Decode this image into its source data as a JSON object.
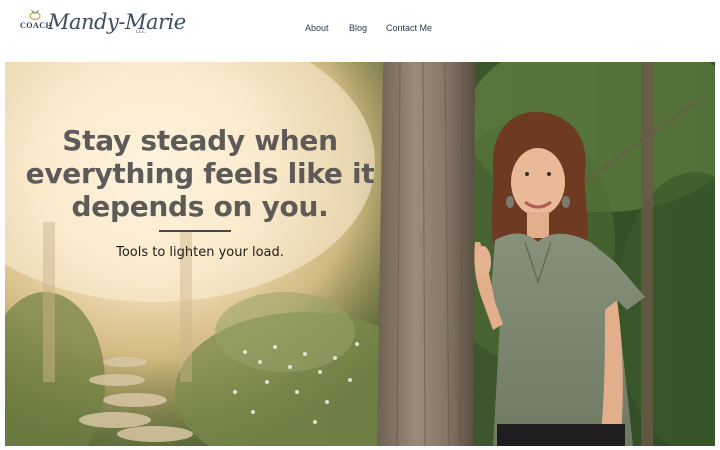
{
  "header": {
    "logo": {
      "prefix": "COACH",
      "name": "Mandy-Marie",
      "suffix": "LLC",
      "icon": "ring-sprout-icon"
    },
    "nav": [
      {
        "label": "About"
      },
      {
        "label": "Blog"
      },
      {
        "label": "Contact Me"
      }
    ]
  },
  "hero": {
    "headline": "Stay steady when everything feels like it depends on you.",
    "tagline": "Tools to lighten your load."
  },
  "colors": {
    "nav_text": "#2b3a4d",
    "headline": "#5d5a58",
    "tagline": "#1f1d1c"
  }
}
